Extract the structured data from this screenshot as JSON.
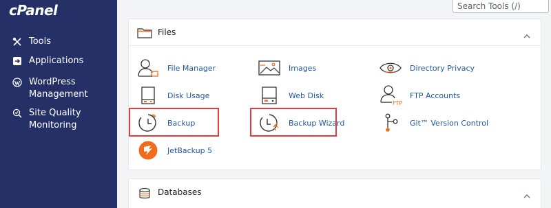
{
  "app": {
    "logo_text": "cPanel"
  },
  "search": {
    "placeholder": "Search Tools (/)"
  },
  "sidebar": {
    "items": [
      {
        "label": "Tools",
        "icon": "tools-icon"
      },
      {
        "label": "Applications",
        "icon": "applications-icon"
      },
      {
        "label": "WordPress Management",
        "icon": "wordpress-icon"
      },
      {
        "label": "Site Quality Monitoring",
        "icon": "site-quality-icon"
      }
    ]
  },
  "files_panel": {
    "title": "Files",
    "icon": "folder-icon",
    "collapse_icon": "chevron-up-icon",
    "items": [
      {
        "label": "File Manager",
        "icon": "file-manager-icon"
      },
      {
        "label": "Images",
        "icon": "images-icon"
      },
      {
        "label": "Directory Privacy",
        "icon": "directory-privacy-icon"
      },
      {
        "label": "Disk Usage",
        "icon": "disk-usage-icon"
      },
      {
        "label": "Web Disk",
        "icon": "web-disk-icon"
      },
      {
        "label": "FTP Accounts",
        "icon": "ftp-accounts-icon"
      },
      {
        "label": "Backup",
        "icon": "backup-icon",
        "highlighted": true
      },
      {
        "label": "Backup Wizard",
        "icon": "backup-wizard-icon",
        "highlighted": true
      },
      {
        "label": "Git™ Version Control",
        "icon": "git-icon"
      },
      {
        "label": "JetBackup 5",
        "icon": "jetbackup-icon"
      }
    ]
  },
  "databases_panel": {
    "title": "Databases",
    "icon": "database-icon",
    "collapse_icon": "chevron-up-icon"
  },
  "colors": {
    "sidebar_bg": "#243066",
    "link": "#1f56a8",
    "accent": "#f26b1d",
    "highlight": "#e23b3b",
    "icon_gray": "#4a4a4a"
  }
}
